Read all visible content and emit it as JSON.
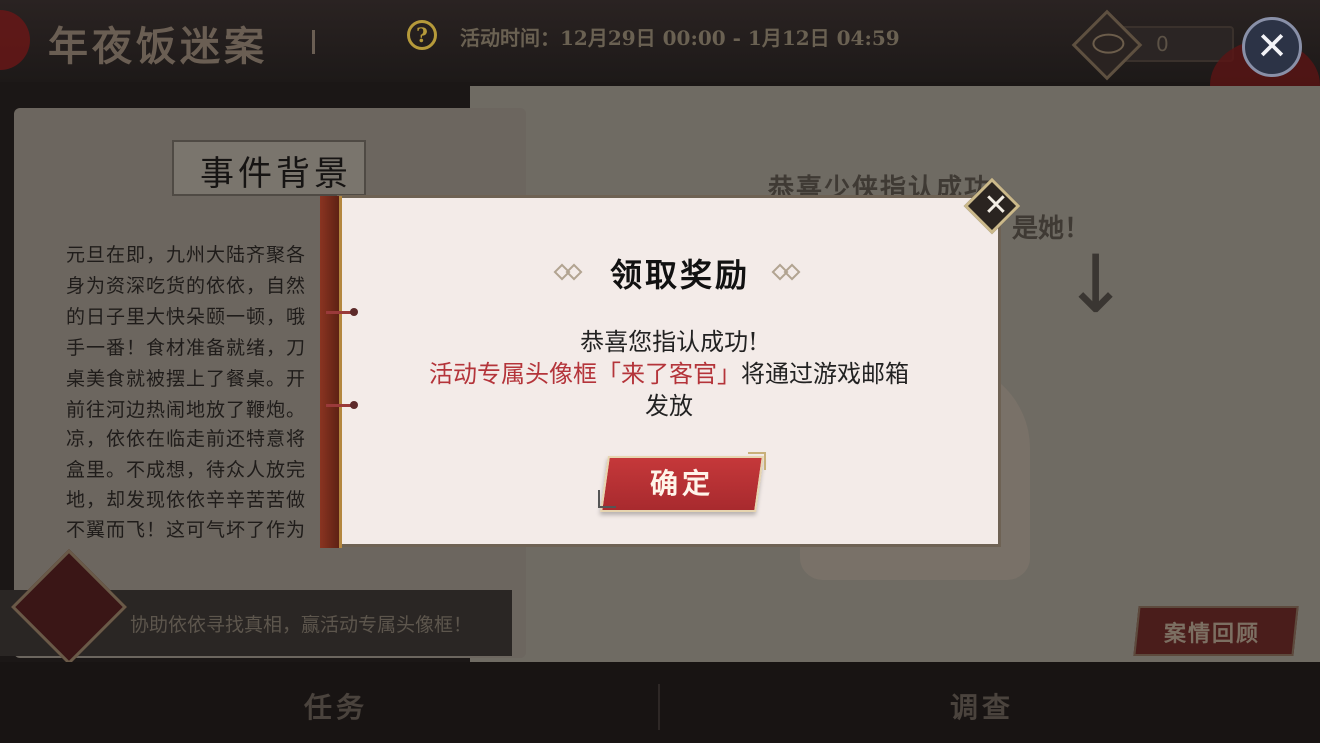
{
  "header": {
    "game_title": "年夜饭迷案",
    "help_icon": "question-icon",
    "event_time": "活动时间：12月29日 00:00 - 1月12日 04:59",
    "eye_count": "0",
    "close_icon": "close-icon"
  },
  "background": {
    "section_title": "事件背景",
    "story_lines": [
      "元旦在即，九州大陆齐聚各",
      "身为资深吃货的依依，自然",
      "的日子里大快朵颐一顿，哦",
      "手一番！食材准备就绪，刀",
      "桌美食就被摆上了餐桌。开",
      "前往河边热闹地放了鞭炮。",
      "凉，依依在临走前还特意将",
      "盒里。不成想，待众人放完",
      "地，却发现依依辛辛苦苦做",
      "不翼而飞！这可气坏了作为"
    ],
    "task_description": "协助依依寻找真相，赢活动专属头像框！",
    "congrats_text": "恭喜少侠指认成功:",
    "her_text": "是她！",
    "review_button": "案情回顾"
  },
  "tabs": {
    "tasks": "任务",
    "investigate": "调查"
  },
  "dialog": {
    "title": "领取奖励",
    "line1": "恭喜您指认成功!",
    "frame_highlight": "活动专属头像框「来了客官」",
    "frame_rest": "将通过游戏邮箱",
    "line3": "发放",
    "confirm_label": "确定"
  }
}
